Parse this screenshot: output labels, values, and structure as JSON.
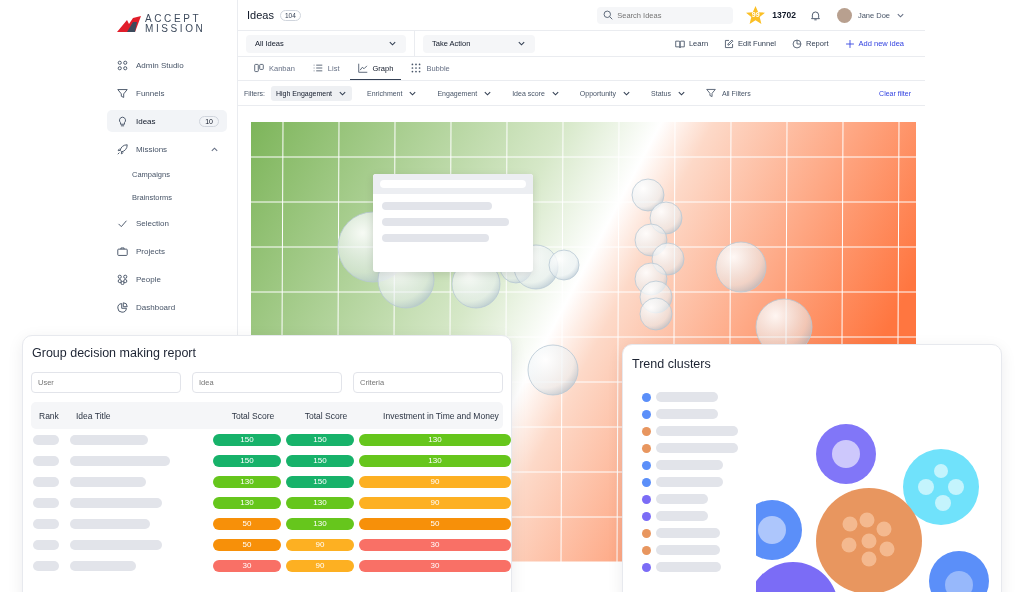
{
  "brand": {
    "line1": "ACCEPT",
    "line2": "MISSION"
  },
  "sidebar": {
    "items": [
      {
        "label": "Admin Studio",
        "selected": false
      },
      {
        "label": "Funnels",
        "selected": false
      },
      {
        "label": "Ideas",
        "selected": true,
        "count": "10"
      },
      {
        "label": "Missions",
        "selected": false,
        "expanded": true,
        "children": [
          {
            "label": "Campaigns",
            "selected": false
          },
          {
            "label": "Brainstorms",
            "selected": false
          }
        ]
      },
      {
        "label": "Selection",
        "selected": false
      },
      {
        "label": "Projects",
        "selected": false
      },
      {
        "label": "People",
        "selected": false
      },
      {
        "label": "Dashboard",
        "selected": false
      }
    ]
  },
  "header": {
    "title": "Ideas",
    "count": "104",
    "search": {
      "placeholder": "Search Ideas"
    },
    "star_badge": "99",
    "points": "13702",
    "user": {
      "name": "Jane Doe"
    }
  },
  "toolbar": {
    "selects": [
      {
        "value": "All Ideas"
      },
      {
        "value": "Take Action"
      }
    ],
    "actions": [
      {
        "label": "Learn",
        "kind": "plain"
      },
      {
        "label": "Edit Funnel",
        "kind": "plain"
      },
      {
        "label": "Report",
        "kind": "plain"
      },
      {
        "label": "Add new idea",
        "kind": "primary"
      }
    ]
  },
  "view_tabs": [
    {
      "label": "Kanban",
      "selected": false
    },
    {
      "label": "List",
      "selected": false
    },
    {
      "label": "Graph",
      "selected": true
    },
    {
      "label": "Bubble",
      "selected": false
    }
  ],
  "filters": {
    "label": "Filters:",
    "items": [
      {
        "label": "High Engagement",
        "selected": true
      },
      {
        "label": "Enrichment",
        "selected": false
      },
      {
        "label": "Engagement",
        "selected": false
      },
      {
        "label": "Idea score",
        "selected": false
      },
      {
        "label": "Opportunity",
        "selected": false
      },
      {
        "label": "Status",
        "selected": false
      }
    ],
    "all_filters": "All Filters",
    "clear": "Clear filter"
  },
  "report": {
    "title": "Group decision making report",
    "fields": [
      {
        "placeholder": "User"
      },
      {
        "placeholder": "Idea"
      },
      {
        "placeholder": "Criteria"
      }
    ],
    "columns": [
      "Rank",
      "Idea Title",
      "Total Score",
      "Total Score",
      "Investment in Time and Money"
    ],
    "rows": [
      {
        "scores": [
          {
            "value": "150",
            "color": "#17b26a"
          },
          {
            "value": "150",
            "color": "#17b26a"
          },
          {
            "value": "130",
            "color": "#66c61c"
          }
        ]
      },
      {
        "scores": [
          {
            "value": "150",
            "color": "#17b26a"
          },
          {
            "value": "150",
            "color": "#17b26a"
          },
          {
            "value": "130",
            "color": "#66c61c"
          }
        ]
      },
      {
        "scores": [
          {
            "value": "130",
            "color": "#66c61c"
          },
          {
            "value": "150",
            "color": "#17b26a"
          },
          {
            "value": "90",
            "color": "#fdb022"
          }
        ]
      },
      {
        "scores": [
          {
            "value": "130",
            "color": "#66c61c"
          },
          {
            "value": "130",
            "color": "#66c61c"
          },
          {
            "value": "90",
            "color": "#fdb022"
          }
        ]
      },
      {
        "scores": [
          {
            "value": "50",
            "color": "#f79009"
          },
          {
            "value": "130",
            "color": "#66c61c"
          },
          {
            "value": "50",
            "color": "#f79009"
          }
        ]
      },
      {
        "scores": [
          {
            "value": "50",
            "color": "#f79009"
          },
          {
            "value": "90",
            "color": "#fdb022"
          },
          {
            "value": "30",
            "color": "#f97066"
          }
        ]
      },
      {
        "scores": [
          {
            "value": "30",
            "color": "#f97066"
          },
          {
            "value": "90",
            "color": "#fdb022"
          },
          {
            "value": "30",
            "color": "#f97066"
          }
        ]
      }
    ]
  },
  "trend_clusters": {
    "title": "Trend clusters",
    "legend": [
      {
        "color": "#5b8ff9"
      },
      {
        "color": "#5b8ff9"
      },
      {
        "color": "#e8965f"
      },
      {
        "color": "#e8965f"
      },
      {
        "color": "#5b8ff9"
      },
      {
        "color": "#5b8ff9"
      },
      {
        "color": "#7b6cf6"
      },
      {
        "color": "#7b6cf6"
      },
      {
        "color": "#e8965f"
      },
      {
        "color": "#e8965f"
      },
      {
        "color": "#7b6cf6"
      }
    ]
  }
}
